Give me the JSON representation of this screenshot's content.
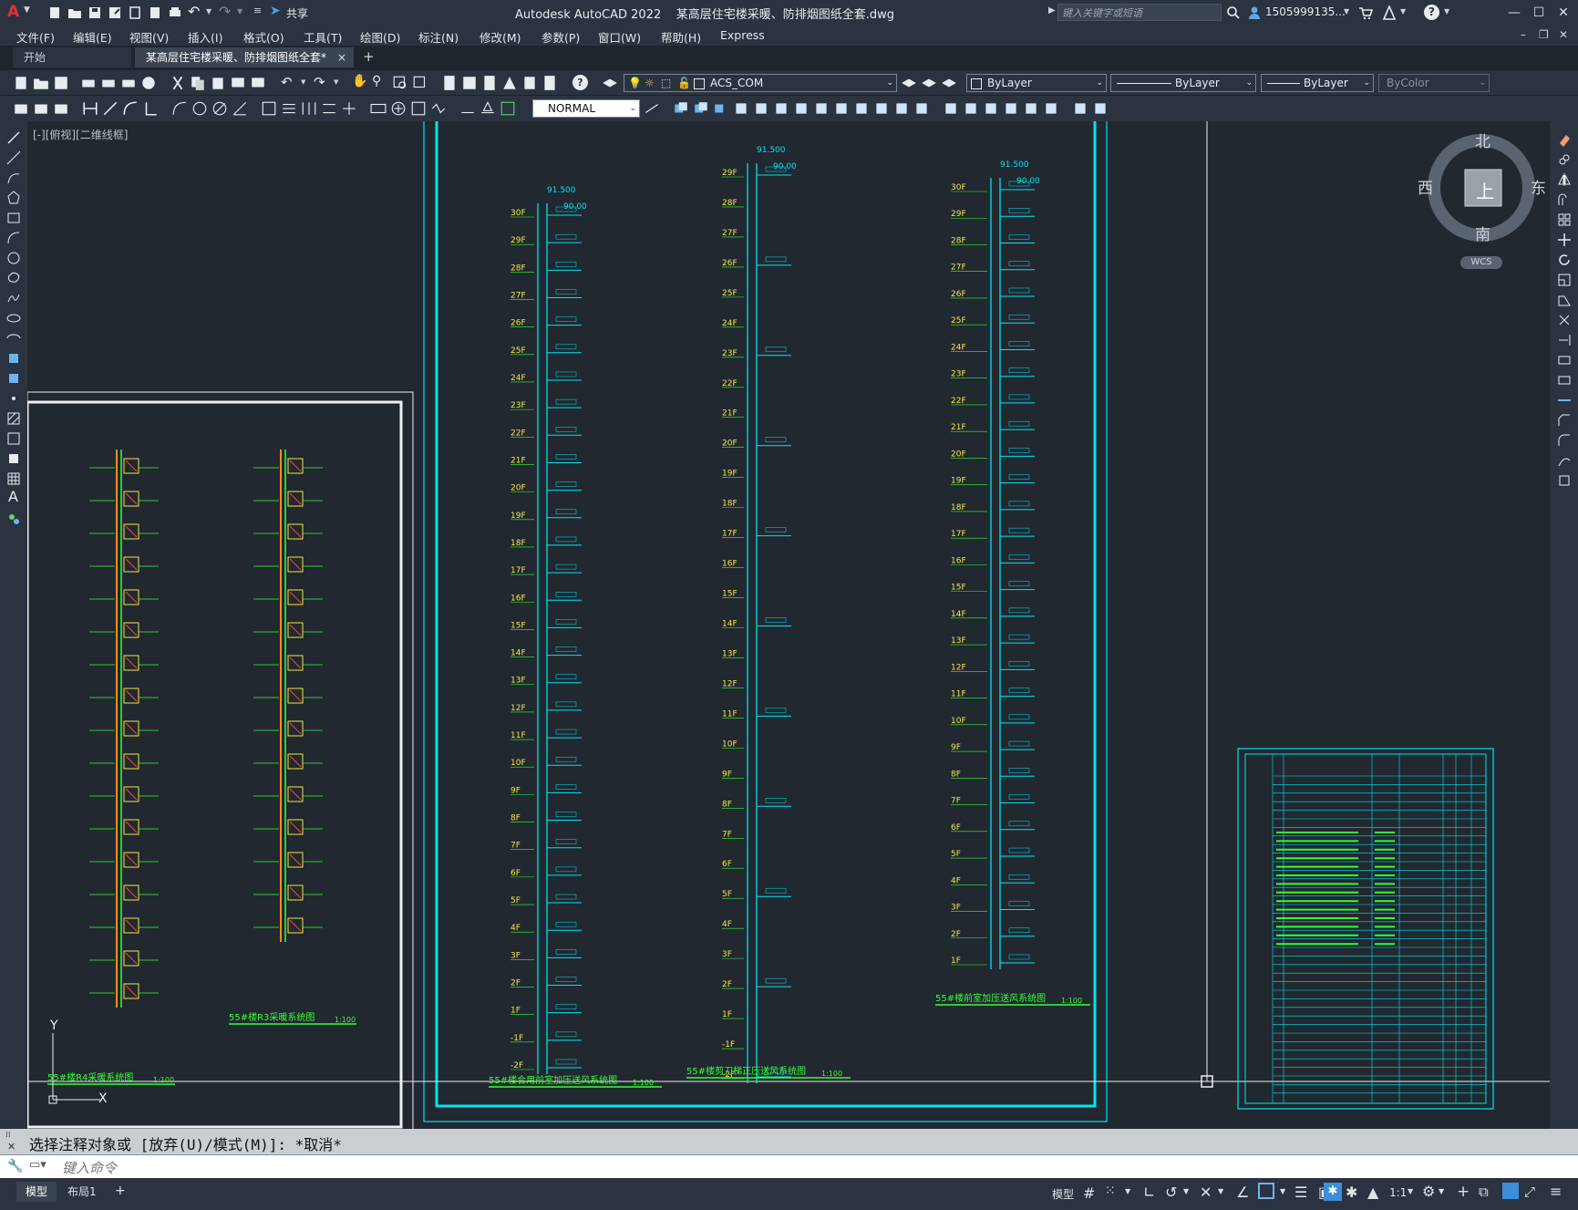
{
  "titlebar": {
    "app_letter": "A",
    "share_label": "共享",
    "title": "Autodesk AutoCAD 2022    某高层住宅楼采暖、防排烟图纸全套.dwg",
    "search_placeholder": "键入关键字或短语",
    "user_name": "1505999135...",
    "help_label": "?"
  },
  "menu": {
    "items": [
      "文件(F)",
      "编辑(E)",
      "视图(V)",
      "插入(I)",
      "格式(O)",
      "工具(T)",
      "绘图(D)",
      "标注(N)",
      "修改(M)",
      "参数(P)",
      "窗口(W)",
      "帮助(H)",
      "Express"
    ]
  },
  "tabs": {
    "start": "开始",
    "drawing": "某高层住宅楼采暖、防排烟图纸全套*",
    "close": "×",
    "add": "+"
  },
  "toolbar": {
    "layer_value": "ACS_COM",
    "color_value": "ByLayer",
    "linetype_value": "ByLayer",
    "lineweight_value": "ByLayer",
    "plotstyle_value": "ByColor",
    "dimstyle_value": "NORMAL"
  },
  "viewport": {
    "label": "[-][俯视][二维线框]"
  },
  "viewcube": {
    "north": "北",
    "south": "南",
    "east": "东",
    "west": "西",
    "top": "上",
    "wcs": "WCS"
  },
  "drawing": {
    "floors_30": [
      "30F",
      "29F",
      "28F",
      "27F",
      "26F",
      "25F",
      "24F",
      "23F",
      "22F",
      "21F",
      "20F",
      "19F",
      "18F",
      "17F",
      "16F",
      "15F",
      "14F",
      "13F",
      "12F",
      "11F",
      "10F",
      "9F",
      "8F",
      "7F",
      "6F",
      "5F",
      "4F",
      "3F",
      "2F",
      "1F",
      "-1F",
      "-2F"
    ],
    "floors_29": [
      "29F",
      "28F",
      "27F",
      "26F",
      "25F",
      "24F",
      "23F",
      "22F",
      "21F",
      "20F",
      "19F",
      "18F",
      "17F",
      "16F",
      "15F",
      "14F",
      "13F",
      "12F",
      "11F",
      "10F",
      "9F",
      "8F",
      "7F",
      "6F",
      "5F",
      "4F",
      "3F",
      "2F",
      "1F",
      "-1F",
      "-2F"
    ],
    "floors_30b": [
      "30F",
      "29F",
      "28F",
      "27F",
      "26F",
      "25F",
      "24F",
      "23F",
      "22F",
      "21F",
      "20F",
      "19F",
      "18F",
      "17F",
      "16F",
      "15F",
      "14F",
      "13F",
      "12F",
      "11F",
      "10F",
      "9F",
      "8F",
      "7F",
      "6F",
      "5F",
      "4F",
      "3F",
      "2F",
      "1F"
    ],
    "elev_1": "91.500",
    "elev_2": "90.00",
    "elev_3": "91.500",
    "elev_4": "90.00",
    "caption_a": "55#楼R4采暖系统图",
    "caption_a_scale": "1:100",
    "caption_b": "55#楼R3采暖系统图",
    "caption_b_scale": "1:100",
    "caption_c": "55#楼合用前室加压送风系统图",
    "caption_c_scale": "1:100",
    "caption_d": "55#楼剪刀梯正压送风系统图",
    "caption_d_scale": "1:100",
    "caption_e": "55#楼前室加压送风系统图",
    "caption_e_scale": "1:100",
    "ucs_y": "Y",
    "ucs_x": "X"
  },
  "command": {
    "history": "选择注释对象或 [放弃(U)/模式(M)]: *取消*",
    "input_placeholder": "键入命令"
  },
  "status": {
    "model_tab": "模型",
    "layout_tab": "布局1",
    "add": "+",
    "model_label": "模型",
    "scale": "1:1"
  }
}
